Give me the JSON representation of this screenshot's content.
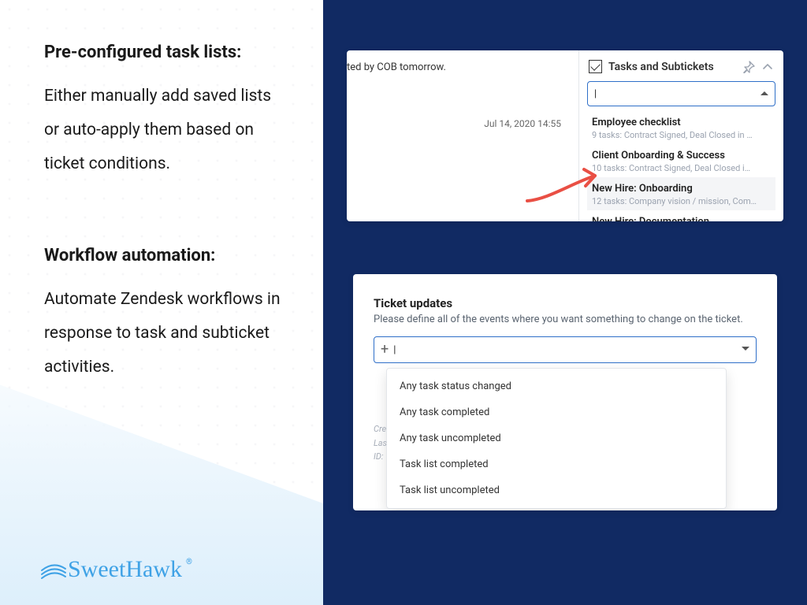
{
  "left": {
    "blocks": [
      {
        "title": "Pre-configured task lists:",
        "body": "Either manually add saved lists or auto-apply them based on ticket conditions."
      },
      {
        "title": "Workflow automation:",
        "body": "Automate Zendesk workflows in response to task and subticket activities."
      }
    ],
    "brand": "SweetHawk"
  },
  "card1": {
    "fragment": "ted by COB tomorrow.",
    "timestamp": "Jul 14, 2020 14:55",
    "panel_title": "Tasks and Subtickets",
    "options": [
      {
        "name": "Employee checklist",
        "sub": "9 tasks: Contract Signed, Deal Closed in …"
      },
      {
        "name": "Client Onboarding & Success",
        "sub": "10 tasks: Contract Signed, Deal Closed i…"
      },
      {
        "name": "New Hire: Onboarding",
        "sub": "12 tasks: Company vision / mission, Com…",
        "highlight": true
      },
      {
        "name": "New Hire: Documentation",
        "sub": ""
      }
    ]
  },
  "card2": {
    "heading": "Ticket updates",
    "desc": "Please define all of the events where you want something to change on the ticket.",
    "options": [
      "Any task status changed",
      "Any task completed",
      "Any task uncompleted",
      "Task list completed",
      "Task list uncompleted"
    ],
    "meta": [
      "Cre",
      "Las",
      "ID:"
    ]
  }
}
